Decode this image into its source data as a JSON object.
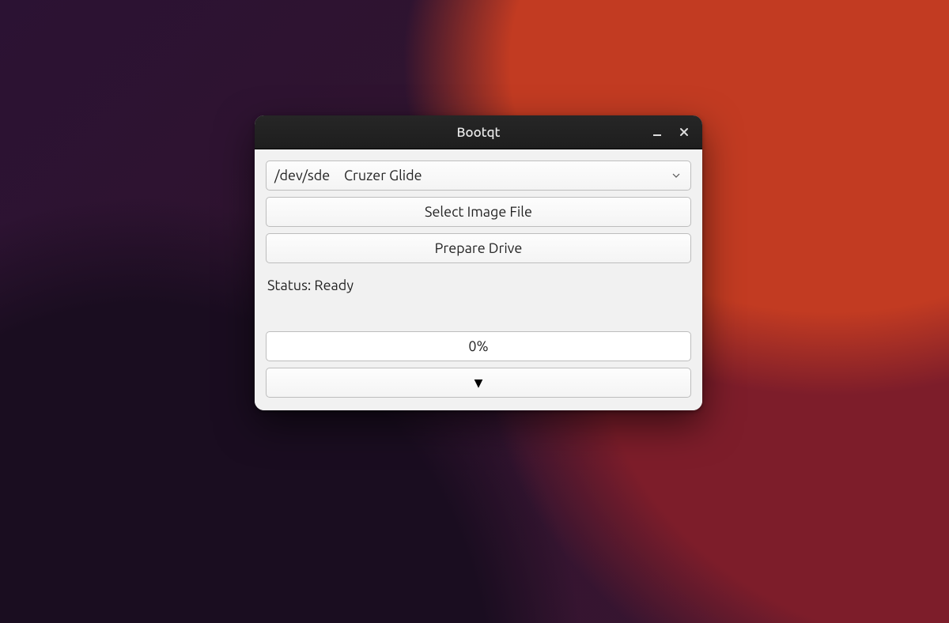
{
  "window": {
    "title": "Bootqt"
  },
  "drive_selector": {
    "device": "/dev/sde",
    "label": "Cruzer Glide"
  },
  "buttons": {
    "select_image": "Select Image File",
    "prepare_drive": "Prepare Drive"
  },
  "status_text": "Status: Ready",
  "progress": {
    "percent_text": "0%",
    "value": 0
  },
  "expand_glyph": "▼"
}
